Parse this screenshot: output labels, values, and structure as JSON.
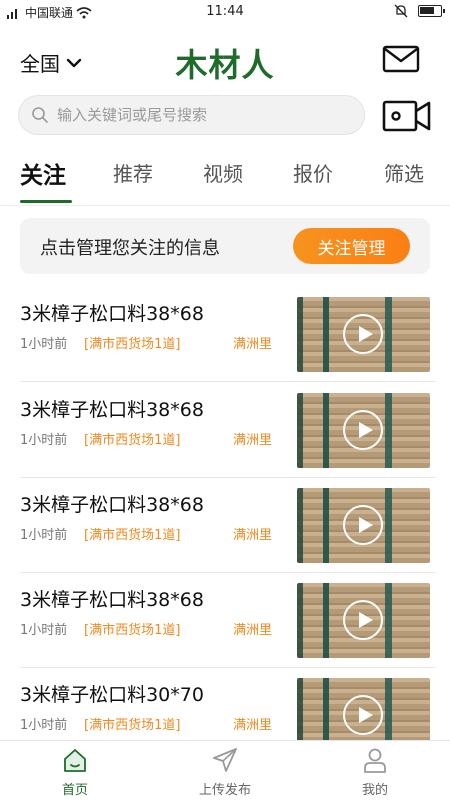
{
  "status_bar": {
    "carrier": "中国联通",
    "time": "11:44",
    "battery_level": 0.75
  },
  "header": {
    "region_label": "全国",
    "logo_text": "木材人"
  },
  "search": {
    "placeholder": "输入关键词或尾号搜索"
  },
  "tabs": [
    {
      "label": "关注",
      "active": true
    },
    {
      "label": "推荐",
      "active": false
    },
    {
      "label": "视频",
      "active": false
    },
    {
      "label": "报价",
      "active": false
    },
    {
      "label": "筛选",
      "active": false
    }
  ],
  "banner": {
    "text": "点击管理您关注的信息",
    "button_label": "关注管理"
  },
  "items": [
    {
      "title": "3米樟子松口料38*68",
      "time": "1小时前",
      "market": "[满市西货场1道]",
      "district": "满洲里"
    },
    {
      "title": "3米樟子松口料38*68",
      "time": "1小时前",
      "market": "[满市西货场1道]",
      "district": "满洲里"
    },
    {
      "title": "3米樟子松口料38*68",
      "time": "1小时前",
      "market": "[满市西货场1道]",
      "district": "满洲里"
    },
    {
      "title": "3米樟子松口料38*68",
      "time": "1小时前",
      "market": "[满市西货场1道]",
      "district": "满洲里"
    },
    {
      "title": "3米樟子松口料30*70",
      "time": "1小时前",
      "market": "[满市西货场1道]",
      "district": "满洲里"
    }
  ],
  "bottom_nav": [
    {
      "label": "首页",
      "icon": "home-icon",
      "active": true
    },
    {
      "label": "上传发布",
      "icon": "send-icon",
      "active": false
    },
    {
      "label": "我的",
      "icon": "user-icon",
      "active": false
    }
  ],
  "colors": {
    "brand": "#1f6b2c",
    "accent_orange": "#f7931e",
    "tag_orange": "#f08a1f"
  }
}
